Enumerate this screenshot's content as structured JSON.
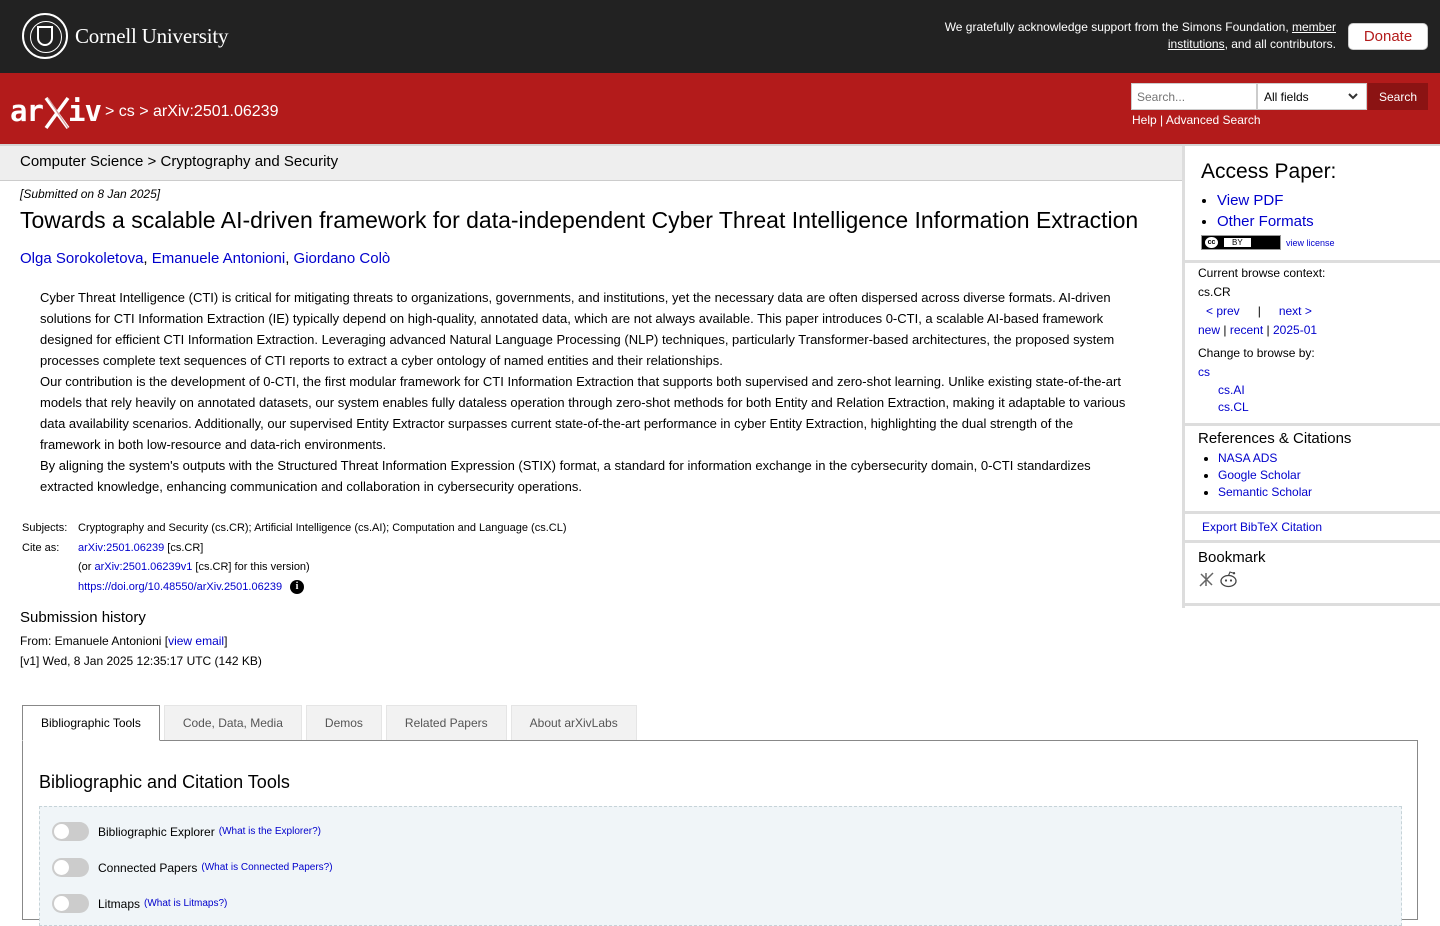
{
  "cornell": {
    "name": "Cornell University",
    "support_prefix": "We gratefully acknowledge support from the Simons Foundation, ",
    "support_link": "member institutions",
    "support_suffix": ", and all contributors.",
    "donate_label": "Donate"
  },
  "header": {
    "crumb_sep1": " > ",
    "crumb_cs": "cs",
    "crumb_sep2": " > ",
    "crumb_id": "arXiv:2501.06239",
    "search_placeholder": "Search...",
    "field_select": "All fields",
    "search_button": "Search",
    "help_link": "Help",
    "links_sep": " | ",
    "advanced_link": "Advanced Search"
  },
  "category_bar": "Computer Science > Cryptography and Security",
  "paper": {
    "dateline": "[Submitted on 8 Jan 2025]",
    "title": "Towards a scalable AI-driven framework for data-independent Cyber Threat Intelligence Information Extraction",
    "authors": [
      "Olga Sorokoletova",
      "Emanuele Antonioni",
      "Giordano Colò"
    ],
    "author_sep": ", ",
    "abstract": [
      "Cyber Threat Intelligence (CTI) is critical for mitigating threats to organizations, governments, and institutions, yet the necessary data are often dispersed across diverse formats. AI-driven solutions for CTI Information Extraction (IE) typically depend on high-quality, annotated data, which are not always available. This paper introduces 0-CTI, a scalable AI-based framework designed for efficient CTI Information Extraction. Leveraging advanced Natural Language Processing (NLP) techniques, particularly Transformer-based architectures, the proposed system processes complete text sequences of CTI reports to extract a cyber ontology of named entities and their relationships.",
      "Our contribution is the development of 0-CTI, the first modular framework for CTI Information Extraction that supports both supervised and zero-shot learning. Unlike existing state-of-the-art models that rely heavily on annotated datasets, our system enables fully dataless operation through zero-shot methods for both Entity and Relation Extraction, making it adaptable to various data availability scenarios. Additionally, our supervised Entity Extractor surpasses current state-of-the-art performance in cyber Entity Extraction, highlighting the dual strength of the framework in both low-resource and data-rich environments.",
      "By aligning the system's outputs with the Structured Threat Information Expression (STIX) format, a standard for information exchange in the cybersecurity domain, 0-CTI standardizes extracted knowledge, enhancing communication and collaboration in cybersecurity operations."
    ],
    "subjects_label": "Subjects:",
    "subjects": "Cryptography and Security (cs.CR); Artificial Intelligence (cs.AI); Computation and Language (cs.CL)",
    "cite_label": "Cite as:",
    "cite_id": "arXiv:2501.06239",
    "cite_cat": " [cs.CR]",
    "cite_or": "(or ",
    "cite_version": "arXiv:2501.06239v1",
    "cite_version_suffix": " [cs.CR] for this version)",
    "doi": "https://doi.org/10.48550/arXiv.2501.06239",
    "submission_title": "Submission history",
    "from_prefix": "From: Emanuele Antonioni [",
    "view_email": "view email",
    "from_suffix": "]",
    "v1": "[v1] Wed, 8 Jan 2025 12:35:17 UTC (142 KB)"
  },
  "sidebar": {
    "access_title": "Access Paper:",
    "view_pdf": "View PDF",
    "other_formats": "Other Formats",
    "cc_label": "cc",
    "cc_by": "BY",
    "view_license": "view license",
    "browse_context_label": "Current browse context:",
    "browse_context": "cs.CR",
    "prev": "< prev",
    "nav_sep": "|",
    "next": "next >",
    "new": "new",
    "recent": "recent",
    "month": "2025-01",
    "change_browse_label": "Change to browse by:",
    "browse_cs": "cs",
    "browse_ai": "cs.AI",
    "browse_cl": "cs.CL",
    "refs_title": "References & Citations",
    "refs": [
      "NASA ADS",
      "Google Scholar",
      "Semantic Scholar"
    ],
    "bibtex": "Export BibTeX Citation",
    "bookmark_title": "Bookmark"
  },
  "tabs": [
    "Bibliographic Tools",
    "Code, Data, Media",
    "Demos",
    "Related Papers",
    "About arXivLabs"
  ],
  "panel": {
    "title": "Bibliographic and Citation Tools",
    "tools": [
      {
        "name": "Bibliographic Explorer",
        "what": "(What is the Explorer?)"
      },
      {
        "name": "Connected Papers",
        "what": "(What is Connected Papers?)"
      },
      {
        "name": "Litmaps",
        "what": "(What is Litmaps?)"
      }
    ]
  }
}
